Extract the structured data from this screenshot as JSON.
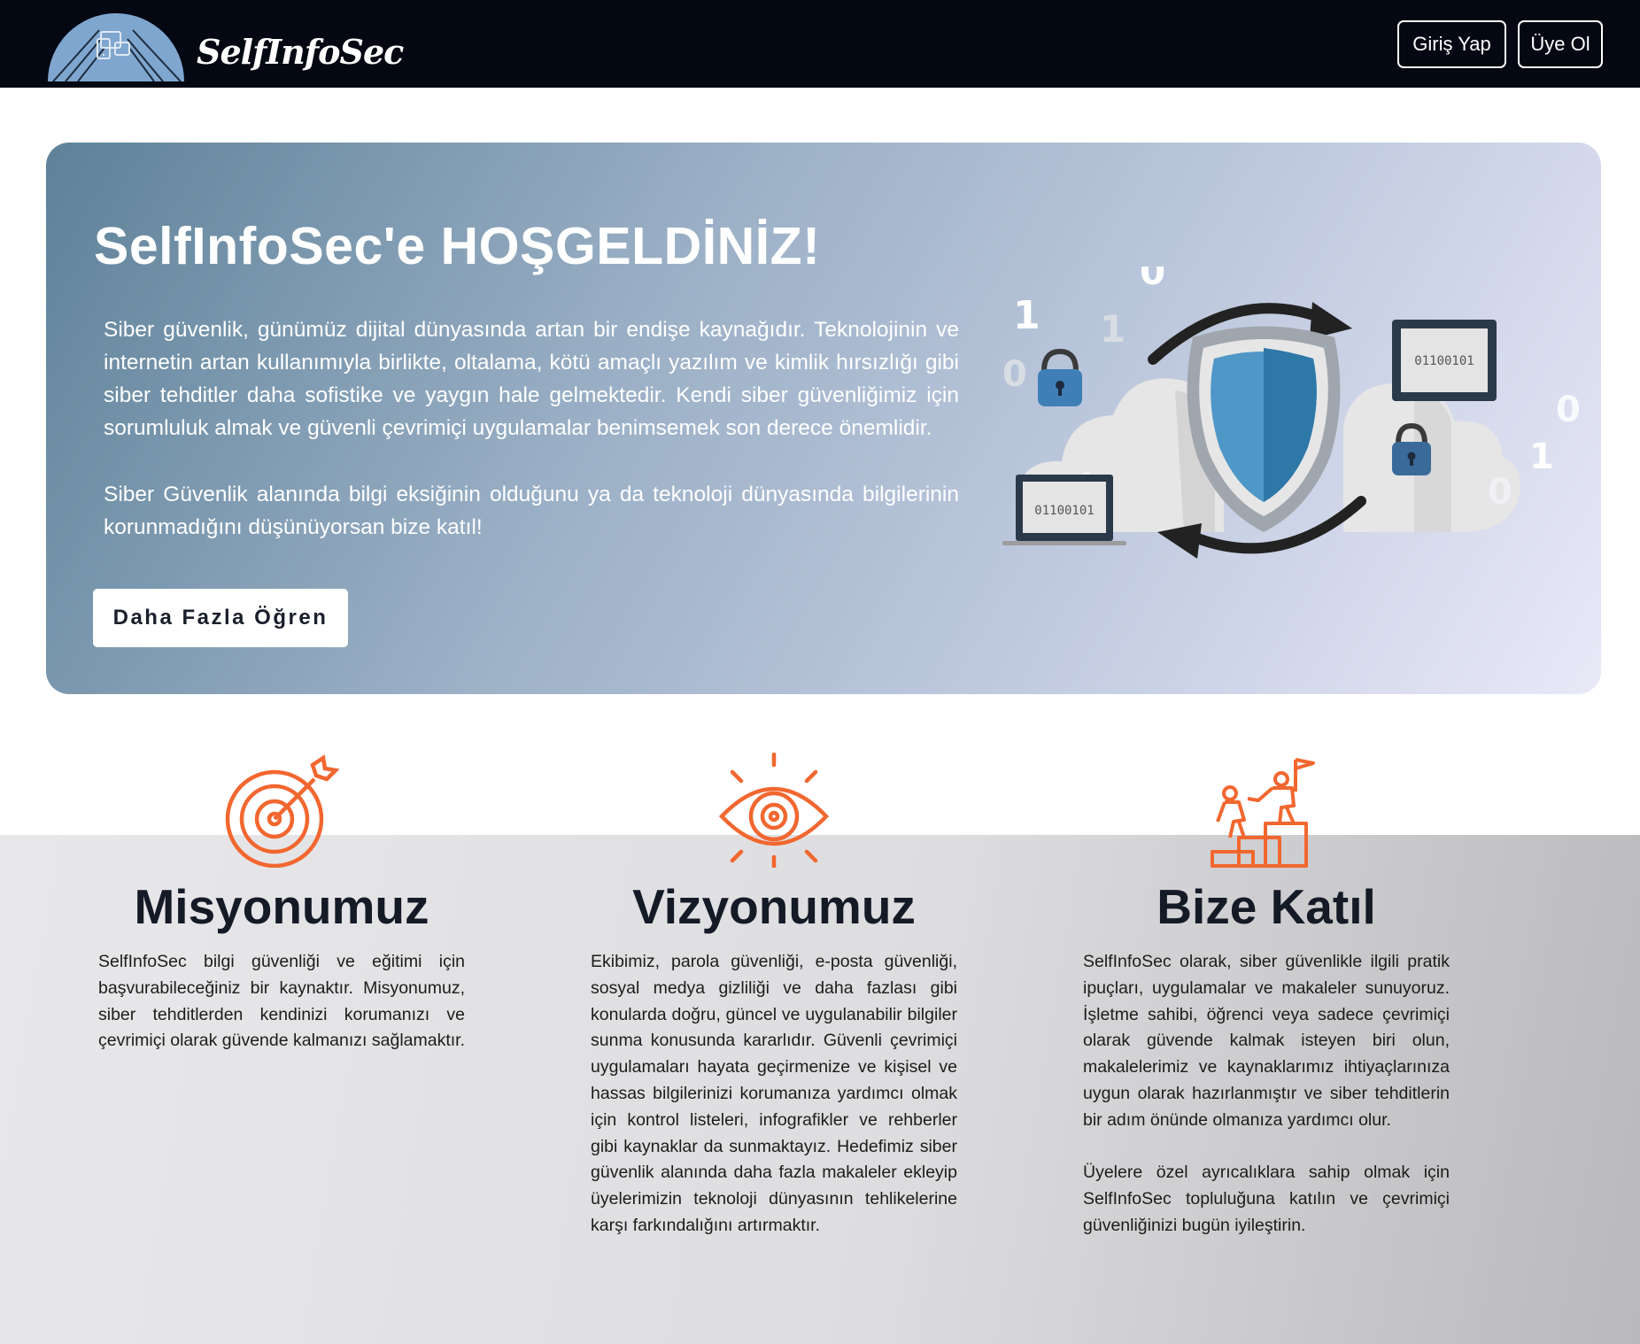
{
  "navbar": {
    "brand": "SelfInfoSec",
    "login_label": "Giriş Yap",
    "register_label": "Üye Ol",
    "logo_icon": "devices-icon"
  },
  "hero": {
    "title": "SelfInfoSec'e HOŞGELDİNİZ!",
    "paragraph1": "Siber güvenlik, günümüz dijital dünyasında artan bir endişe kaynağıdır. Teknolojinin ve internetin artan kullanımıyla birlikte, oltalama, kötü amaçlı yazılım ve kimlik hırsızlığı gibi siber tehditler daha sofistike ve yaygın hale gelmektedir. Kendi siber güvenliğimiz için sorumluluk almak ve güvenli çevrimiçi uygulamalar benimsemek son derece önemlidir.",
    "paragraph2": "Siber Güvenlik alanında bilgi eksiğinin olduğunu ya da teknoloji dünyasında bilgilerinin korunmadığını düşünüyorsan bize katıl!",
    "cta_label": "Daha Fazla Öğren",
    "illustration": {
      "screen_text": "01100101",
      "digits": [
        "1",
        "0",
        "1",
        "0",
        "0",
        "1",
        "0"
      ]
    }
  },
  "features": [
    {
      "icon": "target-icon",
      "title": "Misyonumuz",
      "paragraphs": [
        "SelfInfoSec bilgi güvenliği ve eğitimi için başvurabileceğiniz bir kaynaktır. Misyonumuz, siber tehditlerden kendinizi korumanızı ve çevrimiçi olarak güvende kalmanızı sağlamaktır."
      ]
    },
    {
      "icon": "eye-icon",
      "title": "Vizyonumuz",
      "paragraphs": [
        "Ekibimiz, parola güvenliği, e-posta güvenliği, sosyal medya gizliliği ve daha fazlası gibi konularda doğru, güncel ve uygulanabilir bilgiler sunma konusunda kararlıdır. Güvenli çevrimiçi uygulamaları hayata geçirmenize ve kişisel ve hassas bilgilerinizi korumanıza yardımcı olmak için kontrol listeleri, infografikler ve rehberler gibi kaynaklar da sunmaktayız. Hedefimiz siber güvenlik alanında daha fazla makaleler ekleyip üyelerimizin teknoloji dünyasının tehlikelerine karşı farkındalığını artırmaktır."
      ]
    },
    {
      "icon": "team-climb-icon",
      "title": "Bize Katıl",
      "paragraphs": [
        "SelfInfoSec olarak, siber güvenlikle ilgili pratik ipuçları, uygulamalar ve makaleler sunuyoruz. İşletme sahibi, öğrenci veya sadece çevrimiçi olarak güvende kalmak isteyen biri olun, makalelerimiz ve kaynaklarımız ihtiyaçlarınıza uygun olarak hazırlanmıştır ve siber tehditlerin bir adım önünde olmanıza yardımcı olur.",
        "Üyelere özel ayrıcalıklara sahip olmak için SelfInfoSec topluluğuna katılın ve çevrimiçi güvenliğinizi bugün iyileştirin."
      ]
    }
  ],
  "colors": {
    "navbar_bg": "#030812",
    "accent_orange": "#f2672f",
    "title_dark": "#141a26",
    "shield_blue": "#3d86b8"
  }
}
